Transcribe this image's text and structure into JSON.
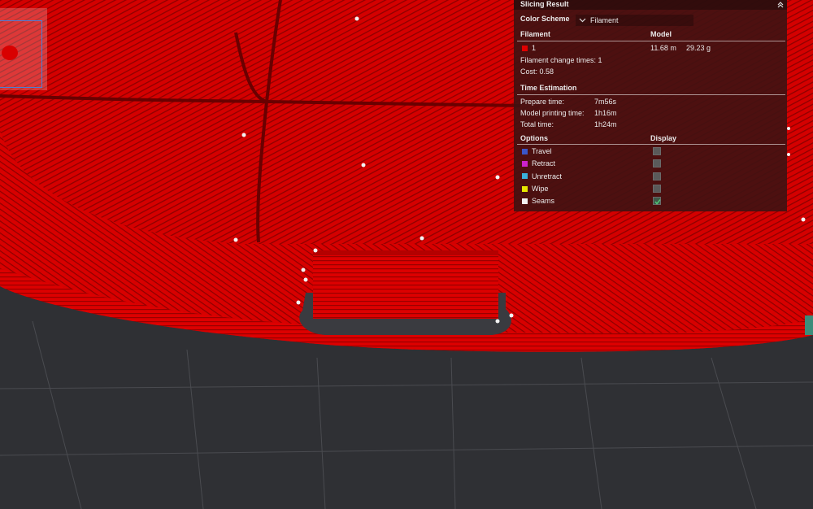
{
  "panel": {
    "title": "Slicing Result",
    "collapse_icon": "chevron-double-up-icon",
    "color_scheme": {
      "label": "Color Scheme",
      "value": "Filament",
      "icon": "chevron-down-icon"
    },
    "filament_section": {
      "header_left": "Filament",
      "header_right": "Model",
      "rows": [
        {
          "index": "1",
          "color": "#e00000",
          "length": "11.68 m",
          "weight": "29.23 g"
        }
      ],
      "change_times": "Filament change times:  1",
      "cost": "Cost:  0.58"
    },
    "time_section": {
      "header": "Time Estimation",
      "items": [
        {
          "label": "Prepare time:",
          "value": "7m56s"
        },
        {
          "label": "Model printing time:",
          "value": "1h16m"
        },
        {
          "label": "Total time:",
          "value": "1h24m"
        }
      ]
    },
    "options_section": {
      "header_left": "Options",
      "header_right": "Display",
      "items": [
        {
          "label": "Travel",
          "color": "#3a56c8",
          "checked": false
        },
        {
          "label": "Retract",
          "color": "#cc22cc",
          "checked": false
        },
        {
          "label": "Unretract",
          "color": "#3aaed8",
          "checked": false
        },
        {
          "label": "Wipe",
          "color": "#e6e600",
          "checked": false
        },
        {
          "label": "Seams",
          "color": "#f2f2f2",
          "checked": true
        }
      ]
    }
  },
  "colors": {
    "filament": "#d40000",
    "bed": "#2f3034",
    "grid": "#4a4b50",
    "panel_bg": "#3e1212"
  }
}
